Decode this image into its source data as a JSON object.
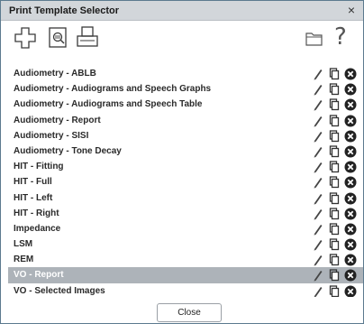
{
  "window": {
    "title": "Print Template Selector",
    "close_glyph": "×"
  },
  "toolbar": {
    "icons": [
      "plus-icon",
      "search-document-icon",
      "printer-icon",
      "folder-icon",
      "help-icon"
    ],
    "help_glyph": "?"
  },
  "templates": [
    {
      "label": "Audiometry - ABLB",
      "selected": false
    },
    {
      "label": "Audiometry - Audiograms and Speech Graphs",
      "selected": false
    },
    {
      "label": "Audiometry - Audiograms and Speech Table",
      "selected": false
    },
    {
      "label": "Audiometry - Report",
      "selected": false
    },
    {
      "label": "Audiometry - SISI",
      "selected": false
    },
    {
      "label": "Audiometry - Tone Decay",
      "selected": false
    },
    {
      "label": "HIT - Fitting",
      "selected": false
    },
    {
      "label": "HIT - Full",
      "selected": false
    },
    {
      "label": "HIT - Left",
      "selected": false
    },
    {
      "label": "HIT - Right",
      "selected": false
    },
    {
      "label": "Impedance",
      "selected": false
    },
    {
      "label": "LSM",
      "selected": false
    },
    {
      "label": "REM",
      "selected": false
    },
    {
      "label": "VO - Report",
      "selected": true
    },
    {
      "label": "VO - Selected Images",
      "selected": false
    }
  ],
  "row_action_icons": [
    "pencil-icon",
    "copy-icon",
    "delete-icon"
  ],
  "footer": {
    "close_label": "Close"
  },
  "colors": {
    "selected_row": "#adb3b9",
    "titlebar": "#d2d6da"
  }
}
